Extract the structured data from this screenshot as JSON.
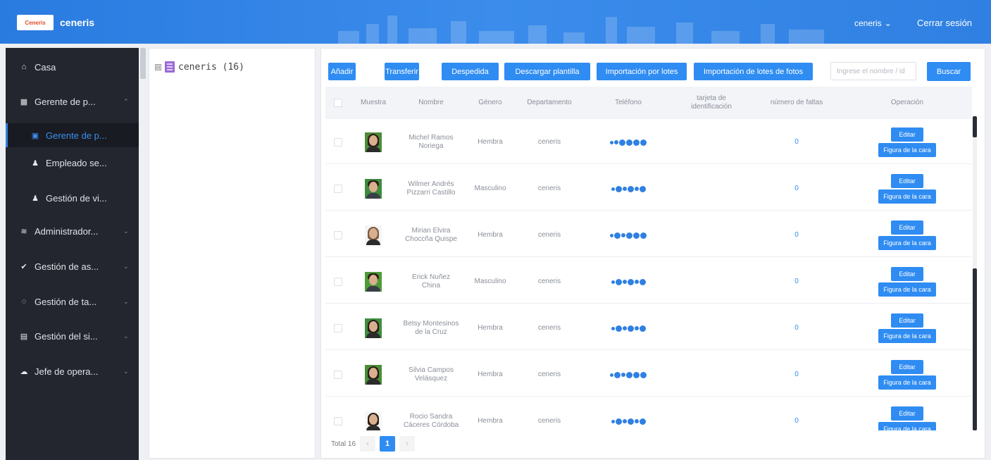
{
  "header": {
    "logo_text": "Ceneris",
    "brand": "ceneris",
    "user": "ceneris",
    "logout": "Cerrar sesión"
  },
  "sidebar": {
    "items": [
      {
        "label": "Casa",
        "icon": "home-icon"
      },
      {
        "label": "Gerente de p...",
        "icon": "building-icon"
      },
      {
        "label": "Gerente de p...",
        "icon": "id-card-icon"
      },
      {
        "label": "Empleado se...",
        "icon": "user-icon"
      },
      {
        "label": "Gestión de vi...",
        "icon": "user-icon"
      },
      {
        "label": "Administrador...",
        "icon": "layers-icon"
      },
      {
        "label": "Gestión de as...",
        "icon": "check-circle-icon"
      },
      {
        "label": "Gestión de ta...",
        "icon": "tag-icon"
      },
      {
        "label": "Gestión del si...",
        "icon": "monitor-icon"
      },
      {
        "label": "Jefe de opera...",
        "icon": "cloud-icon"
      }
    ]
  },
  "tree": {
    "toggle": "⊟",
    "root_label": "ceneris (16)"
  },
  "toolbar": {
    "add": "Añadir",
    "transfer": "Transferir",
    "dismiss": "Despedida",
    "download_template": "Descargar plantilla",
    "batch_import": "Importación por lotes",
    "batch_photo_import": "Importación de lotes de fotos",
    "search_placeholder": "Ingrese el nombre / id",
    "search": "Buscar"
  },
  "table": {
    "headers": {
      "sample": "Muestra",
      "name": "Nombre",
      "gender": "Género",
      "department": "Departamento",
      "phone": "Teléfono",
      "id_card": "tarjeta de identificación",
      "faults": "número de faltas",
      "operation": "Operación"
    },
    "rows": [
      {
        "name": "Michel Ramos Noriega",
        "gender": "Hembra",
        "department": "ceneris",
        "phone": "9●●67●●●",
        "faults": "0",
        "photo": "woman-dark-hair",
        "bg": "#4d8b3a"
      },
      {
        "name": "Wilmer Andrés Pizzarri Castillo",
        "gender": "Masculino",
        "department": "ceneris",
        "phone": "9●●1●●3●●",
        "faults": "0",
        "photo": "man-short-hair",
        "bg": "#3f8a40"
      },
      {
        "name": "Mirian Elvira Choccña Quispe",
        "gender": "Hembra",
        "department": "ceneris",
        "phone": "9●●53●●9●●",
        "faults": "0",
        "photo": "woman-light-hair",
        "bg": "#f4f4f4"
      },
      {
        "name": "Erick Nuñez China",
        "gender": "Masculino",
        "department": "ceneris",
        "phone": "9●●07●●●",
        "faults": "0",
        "photo": "man-short-hair",
        "bg": "#4f9a3a"
      },
      {
        "name": "Betsy Montesinos de la Cruz",
        "gender": "Hembra",
        "department": "ceneris",
        "phone": "9●●7●●3●●",
        "faults": "0",
        "photo": "woman-dark-hair",
        "bg": "#3f8d3f"
      },
      {
        "name": "Silvia Campos Velásquez",
        "gender": "Hembra",
        "department": "ceneris",
        "phone": "9●●16●●●",
        "faults": "0",
        "photo": "woman-dark-hair",
        "bg": "#4a8c38"
      },
      {
        "name": "Rocio Sandra Cáceres Córdoba",
        "gender": "Hembra",
        "department": "ceneris",
        "phone": "9●●75●●8●●",
        "faults": "0",
        "photo": "woman-dark-hair",
        "bg": "#f6f6f6"
      }
    ],
    "edit": "Editar",
    "face": "Figura de la cara"
  },
  "pager": {
    "total": "Total 16",
    "prev": "‹",
    "page": "1",
    "next": "›"
  },
  "colors": {
    "primary": "#2f8cf2",
    "header": "#2f7fe0",
    "sidebar": "#23262e"
  }
}
